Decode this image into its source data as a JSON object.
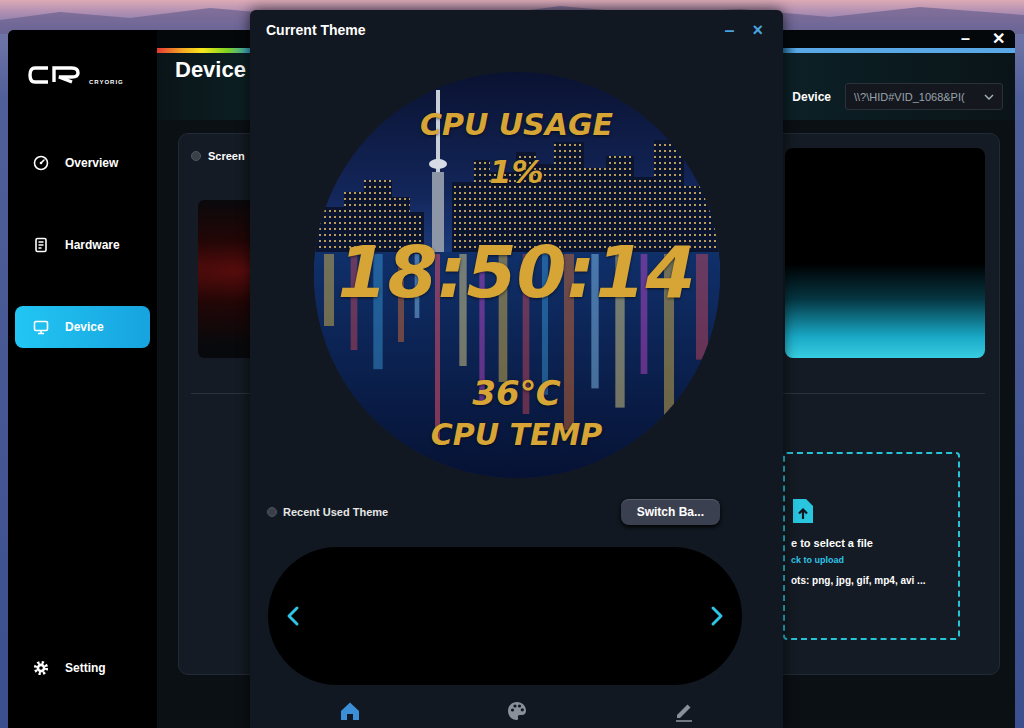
{
  "app_window": {
    "logo": "CRYORIG",
    "minimize": "–",
    "close": "✕",
    "title": "Device",
    "sidebar": {
      "items": [
        {
          "label": "Overview",
          "kind": "gauge",
          "selected": false
        },
        {
          "label": "Hardware",
          "kind": "board",
          "selected": false
        },
        {
          "label": "Device",
          "kind": "monitor",
          "selected": true
        },
        {
          "label": "Setting",
          "kind": "gear",
          "selected": false
        }
      ]
    },
    "device_label": "Device",
    "device_select": "\\\\?\\HID#VID_1068&PI(",
    "screen_label": "Screen",
    "screen_checked": false,
    "upload": {
      "lines": [
        "e to select a file",
        "ck to upload",
        "ots: png, jpg, gif, mp4, avi ..."
      ]
    }
  },
  "dialog": {
    "title": "Current Theme",
    "minimize": "–",
    "close": "×",
    "theme_lines": [
      "CPU USAGE",
      "1%",
      "18:50:14",
      "36℃",
      "CPU TEMP"
    ],
    "recent_label": "Recent Used Theme",
    "recent_checked": false,
    "switch_button": "Switch Ba...",
    "nav": [
      {
        "kind": "home",
        "selected": true
      },
      {
        "kind": "palette",
        "selected": false
      },
      {
        "kind": "edit",
        "selected": false
      }
    ]
  }
}
